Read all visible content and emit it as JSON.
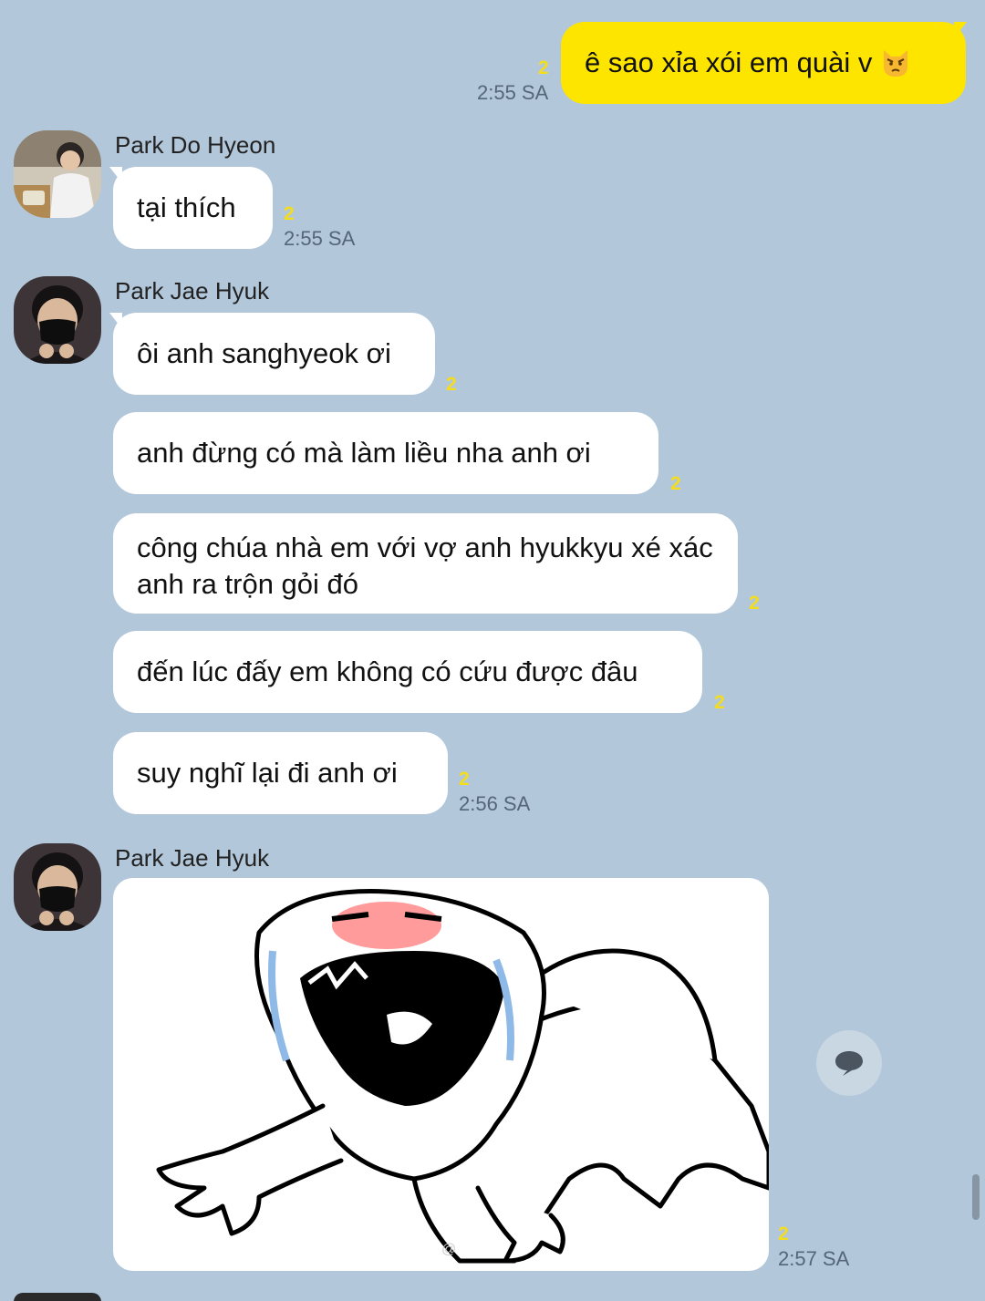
{
  "messages": {
    "m1": {
      "text": "ê sao xỉa xói em quài v",
      "emoji": "pouting-cat-icon",
      "unread": "2",
      "time": "2:55 SA"
    },
    "m2": {
      "sender": "Park Do Hyeon",
      "text": "tại thích",
      "unread": "2",
      "time": "2:55 SA"
    },
    "g3": {
      "sender": "Park Jae Hyuk",
      "bubbles": [
        {
          "text": "ôi anh sanghyeok ơi",
          "unread": "2"
        },
        {
          "text": "anh đừng có mà làm liều nha anh ơi",
          "unread": "2"
        },
        {
          "text": "công chúa nhà em với vợ anh hyukkyu xé xác anh ra trộn gỏi đó",
          "unread": "2"
        },
        {
          "text": "đến lúc đấy em không có cứu được đâu",
          "unread": "2"
        },
        {
          "text": "suy nghĩ lại đi anh ơi",
          "unread": "2"
        }
      ],
      "time": "2:56 SA"
    },
    "m4": {
      "sender": "Park Jae Hyuk",
      "sticker": "crying-screaming-blob-sticker",
      "unread": "2",
      "time": "2:57 SA"
    }
  },
  "colors": {
    "background": "#b2c7da",
    "my_bubble": "#fee500",
    "their_bubble": "#ffffff",
    "unread_count": "#f3dd1c"
  },
  "icons": {
    "reply": "speech-bubble-icon"
  }
}
